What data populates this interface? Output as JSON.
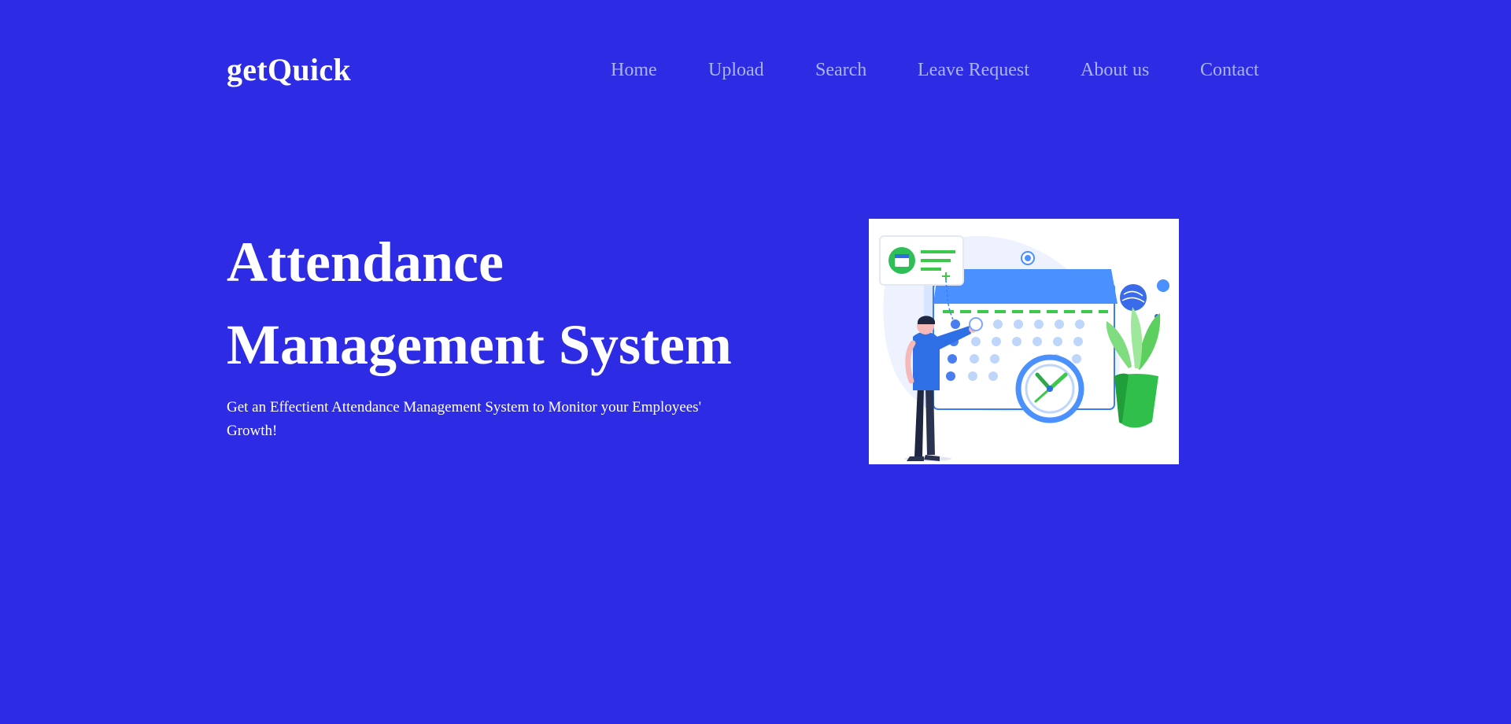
{
  "brand": {
    "name": "getQuick"
  },
  "nav": {
    "items": [
      {
        "label": "Home"
      },
      {
        "label": "Upload"
      },
      {
        "label": "Search"
      },
      {
        "label": "Leave Request"
      },
      {
        "label": "About us"
      },
      {
        "label": "Contact"
      }
    ]
  },
  "hero": {
    "title_line1": "Attendance",
    "title_line2": "Management System",
    "subtitle": "Get an Effectient Attendance Management System to Monitor your Employees' Growth!"
  },
  "colors": {
    "background": "#2d2ce4",
    "nav_text": "#a9b6ef",
    "text": "#ffffff",
    "accent_blue": "#4a90ff",
    "accent_green": "#3cc84a"
  },
  "illustration": {
    "icon": "calendar-attendance-illustration"
  }
}
